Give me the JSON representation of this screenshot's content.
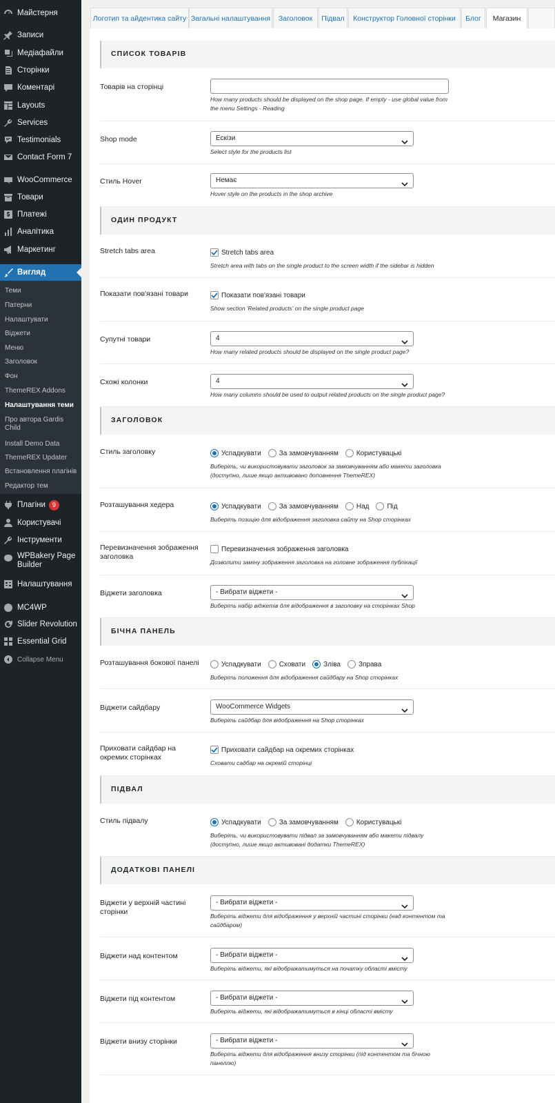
{
  "sidebar": {
    "items": [
      {
        "label": "Майстерня",
        "icon": "dashboard-icon"
      },
      {
        "label": "Записи",
        "icon": "pin-icon"
      },
      {
        "label": "Медіафайли",
        "icon": "media-icon"
      },
      {
        "label": "Сторінки",
        "icon": "page-icon"
      },
      {
        "label": "Коментарі",
        "icon": "comment-icon"
      },
      {
        "label": "Layouts",
        "icon": "layouts-icon"
      },
      {
        "label": "Services",
        "icon": "wrench-icon"
      },
      {
        "label": "Testimonials",
        "icon": "testimonial-icon"
      },
      {
        "label": "Contact Form 7",
        "icon": "mail-icon"
      },
      {
        "label": "WooCommerce",
        "icon": "woocommerce-icon"
      },
      {
        "label": "Товари",
        "icon": "archive-icon"
      },
      {
        "label": "Платежі",
        "icon": "dollar-icon"
      },
      {
        "label": "Аналітика",
        "icon": "chart-icon"
      },
      {
        "label": "Маркетинг",
        "icon": "megaphone-icon"
      },
      {
        "label": "Вигляд",
        "icon": "paintbrush-icon"
      },
      {
        "label": "Плагіни",
        "icon": "plugin-icon",
        "badge": "9"
      },
      {
        "label": "Користувачі",
        "icon": "users-icon"
      },
      {
        "label": "Інструменти",
        "icon": "tools-icon"
      },
      {
        "label": "WPBakery Page Builder",
        "icon": "wpbakery-icon"
      },
      {
        "label": "Налаштування",
        "icon": "settings-icon"
      },
      {
        "label": "MC4WP",
        "icon": "mc4wp-icon"
      },
      {
        "label": "Slider Revolution",
        "icon": "refresh-icon"
      },
      {
        "label": "Essential Grid",
        "icon": "grid-icon"
      },
      {
        "label": "Collapse Menu",
        "icon": "collapse-icon"
      }
    ],
    "submenu": [
      "Теми",
      "Патерни",
      "Налаштувати",
      "Віджети",
      "Меню",
      "Заголовок",
      "Фон",
      "ThemeREX Addons",
      "Налаштування теми",
      "Про автора Gardis Child",
      "Install Demo Data",
      "ThemeREX Updater",
      "Встановлення плагінів",
      "Редактор тем"
    ]
  },
  "tabs": [
    "Логотип та айдентика сайту",
    "Загальні налаштування",
    "Заголовок",
    "Підвал",
    "Конструктор Головної сторінки",
    "Блог",
    "Магазин"
  ],
  "sections": {
    "products_list": "СПИСОК ТОВАРІВ",
    "single_product": "ОДИН ПРОДУКТ",
    "header": "ЗАГОЛОВОК",
    "sidebar": "БІЧНА ПАНЕЛЬ",
    "footer": "ПІДВАЛ",
    "extra_panels": "ДОДАТКОВІ ПАНЕЛІ"
  },
  "fields": {
    "per_page": {
      "label": "Товарів на сторінці",
      "value": "",
      "desc": "How many products should be displayed on the shop page. If empty - use global value from the menu Settings - Reading"
    },
    "shop_mode": {
      "label": "Shop mode",
      "value": "Ескізи",
      "desc": "Select style for the products list"
    },
    "hover": {
      "label": "Стиль Hover",
      "value": "Немає",
      "desc": "Hover style on the products in the shop archive"
    },
    "stretch_tabs": {
      "label": "Stretch tabs area",
      "checkbox": "Stretch tabs area",
      "checked": true,
      "desc": "Stretch area with tabs on the single product to the screen width if the sidebar is hidden"
    },
    "show_related": {
      "label": "Показати пов'язані товари",
      "checkbox": "Показати пов'язані товари",
      "checked": true,
      "desc": "Show section 'Related products' on the single product page"
    },
    "related_count": {
      "label": "Супутні товари",
      "value": "4",
      "desc": "How many related products should be displayed on the single product page?"
    },
    "related_cols": {
      "label": "Схожі колонки",
      "value": "4",
      "desc": "How many columns should be used to output related products on the single product page?"
    },
    "header_style": {
      "label": "Стиль заголовку",
      "options": [
        "Успадкувати",
        "За замовчуванням",
        "Користувацькі"
      ],
      "selected": 0,
      "desc": "Виберіть, чи використовувати заголовок за замовчуванням або макети заголовка (доступно, лише якщо активовано доповнення ThemeREX)"
    },
    "header_position": {
      "label": "Розташування хедера",
      "options": [
        "Успадкувати",
        "За замовчуванням",
        "Над",
        "Під"
      ],
      "selected": 0,
      "desc": "Виберіть позицію для відображення заголовка сайту на Shop сторінках"
    },
    "header_image": {
      "label": "Перевизначення зображення заголовка",
      "checkbox": "Перевизначення зображення заголовка",
      "checked": false,
      "desc": "Дозволити заміну зображення заголовка на головне зображення публікації"
    },
    "header_widgets": {
      "label": "Віджети заголовка",
      "value": "- Вибрати віджети -",
      "desc": "Виберіть набір віджетів для відображення в заголовку на сторінках Shop"
    },
    "sidebar_position": {
      "label": "Розташування бокової панелі",
      "options": [
        "Успадкувати",
        "Сховати",
        "Зліва",
        "Зправа"
      ],
      "selected": 2,
      "desc": "Виберіть положення для відображення сайдбару на Shop сторінках"
    },
    "sidebar_widgets": {
      "label": "Віджети сайдбару",
      "value": "WooCommerce Widgets",
      "desc": "Виберіть сайдбар для відображення на Shop сторінках"
    },
    "hide_sidebar": {
      "label": "Приховати сайдбар на окремих сторінках",
      "checkbox": "Приховати сайдбар на окремих сторінках",
      "checked": true,
      "desc": "Сховати садбар на окремій сторінці"
    },
    "footer_style": {
      "label": "Стиль підвалу",
      "options": [
        "Успадкувати",
        "За замовчуванням",
        "Користувацькі"
      ],
      "selected": 0,
      "desc": "Виберіть, чи використовувати підвал за замовчуванням або макети підвалу (доступно, лише якщо активовані додатки ThemeREX)"
    },
    "widgets_top": {
      "label": "Віджети у верхній частині сторінки",
      "value": "- Вибрати віджети -",
      "desc": "Виберіть віджети для відображення у верхній частині сторінки (над контентом та сайдбаром)"
    },
    "widgets_above": {
      "label": "Віджети над контентом",
      "value": "- Вибрати віджети -",
      "desc": "Виберіть віджети, які відображатимуться на початку області вмісту"
    },
    "widgets_below": {
      "label": "Віджети під контентом",
      "value": "- Вибрати віджети -",
      "desc": "Виберіть віджети, які відображатимуться в кінці області вмісту"
    },
    "widgets_bottom": {
      "label": "Віджети внизу сторінки",
      "value": "- Вибрати віджети -",
      "desc": "Виберіть віджети для відображення внизу сторінки (під контентом та бічною панеллю)"
    }
  }
}
